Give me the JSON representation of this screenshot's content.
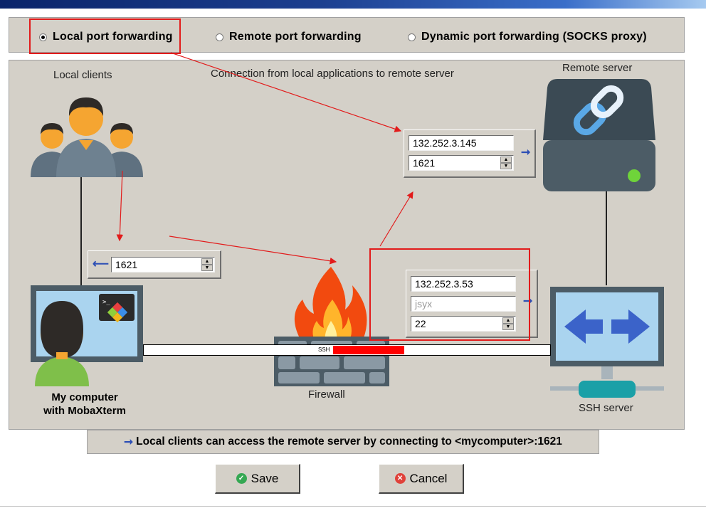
{
  "modes": [
    {
      "label": "Local port forwarding",
      "selected": true
    },
    {
      "label": "Remote port forwarding",
      "selected": false
    },
    {
      "label": "Dynamic port forwarding (SOCKS proxy)",
      "selected": false
    }
  ],
  "diagram": {
    "local_clients_label": "Local clients",
    "connection_label": "Connection from local applications to remote server",
    "remote_server_label": "Remote server",
    "remote_host": "132.252.3.145",
    "remote_port": "1621",
    "local_port": "1621",
    "ssh_host": "132.252.3.53",
    "ssh_user": "jsyx",
    "ssh_port": "22",
    "ssh_tunnel_label": "SSH",
    "my_computer_line1": "My computer",
    "my_computer_line2": "with MobaXterm",
    "firewall_label": "Firewall",
    "ssh_server_label": "SSH server"
  },
  "info": {
    "arrow_icon": "right-arrow-icon",
    "text": "Local clients can access the remote server by connecting to <mycomputer>:1621"
  },
  "buttons": {
    "save_label": "Save",
    "cancel_label": "Cancel"
  },
  "colors": {
    "highlight": "#e21b1b",
    "panel": "#d4d0c8",
    "arrow_blue": "#2d4fb5",
    "ssh_bar": "#ff0000"
  }
}
